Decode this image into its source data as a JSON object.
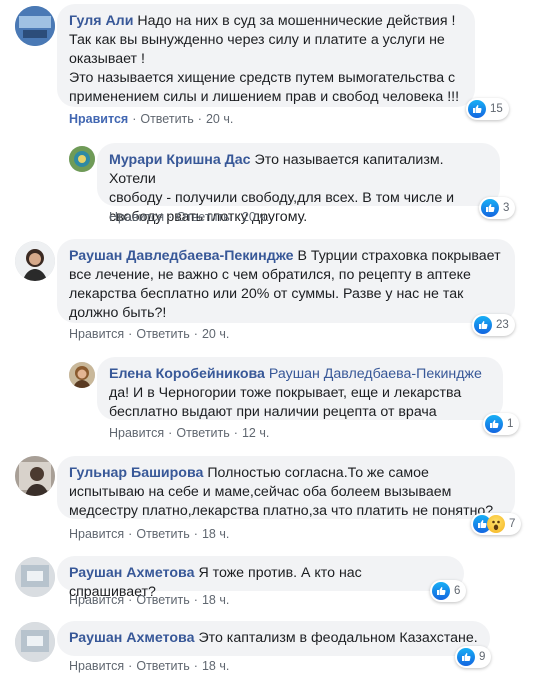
{
  "comments": [
    {
      "author": "Гуля Али",
      "text": "Надо на них в суд за мошеннические действия !\nТак как вы вынужденно через силу и платите а услуги не\nоказывает !\nЭто называется хищение средств путем вымогательства с\nприменением силы и лишением прав и свобод человека !!!",
      "like_label": "Нравится",
      "reply_label": "Ответить",
      "time": "20 ч.",
      "reactions": "15",
      "liked": true
    },
    {
      "author": "Мурари Кришна Дас",
      "text": "Это называется капитализм. Хотели\nсвободу - получили свободу,для всех. В том числе и\nсвободу рвать глотку другому.",
      "like_label": "Нравится",
      "reply_label": "Ответить",
      "time": "20 ч.",
      "reactions": "3"
    },
    {
      "author": "Раушан Давледбаева-Пекиндже",
      "text": "В Турции страховка покрывает\nвсе лечение, не важно с чем обратился, по рецепту в аптеке\nлекарства бесплатно или 20% от суммы. Разве у нас не так\nдолжно быть?!",
      "like_label": "Нравится",
      "reply_label": "Ответить",
      "time": "20 ч.",
      "reactions": "23"
    },
    {
      "author": "Елена Коробейникова",
      "mention": "Раушан Давледбаева-Пекиндже",
      "text": "да! И в Черногории тоже покрывает, еще и лекарства\nбесплатно выдают при наличии рецепта от врача",
      "like_label": "Нравится",
      "reply_label": "Ответить",
      "time": "12 ч.",
      "reactions": "1"
    },
    {
      "author": "Гульнар Баширова",
      "text": "Полностью согласна.То же самое\nиспытываю на себе и маме,сейчас оба болеем вызываем\nмедсестру платно,лекарства платно,за что платить не понятно?",
      "like_label": "Нравится",
      "reply_label": "Ответить",
      "time": "18 ч.",
      "reactions": "7"
    },
    {
      "author": "Раушан Ахметова",
      "text": "Я тоже против. А кто нас спрашивает?",
      "like_label": "Нравится",
      "reply_label": "Ответить",
      "time": "18 ч.",
      "reactions": "6"
    },
    {
      "author": "Раушан Ахметова",
      "text": "Это каптализм в феодальном Казахстане.",
      "like_label": "Нравится",
      "reply_label": "Ответить",
      "time": "18 ч.",
      "reactions": "9"
    }
  ],
  "colors": {
    "author": "#385898",
    "liked": "#4267b2",
    "bubble": "#f2f3f5",
    "meta": "#606770"
  },
  "icons": {
    "like": "like-reaction-icon",
    "wow": "wow-reaction-icon"
  }
}
